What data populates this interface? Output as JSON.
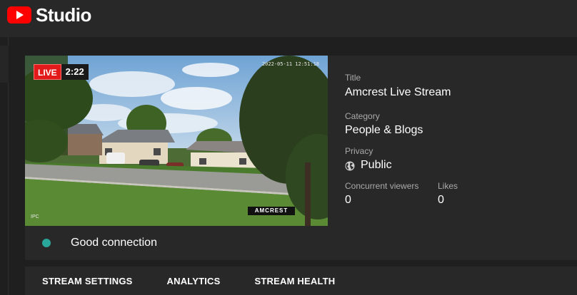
{
  "app": {
    "logo_text": "Studio"
  },
  "video": {
    "live_label": "LIVE",
    "elapsed": "2:22",
    "camera_timestamp": "2022-05-11 12:51:18",
    "camera_label": "IPC",
    "camera_brand": "AMCREST"
  },
  "connection": {
    "status": "Good connection",
    "status_color": "#2aa79b"
  },
  "details": {
    "title_label": "Title",
    "title_value": "Amcrest Live Stream",
    "category_label": "Category",
    "category_value": "People & Blogs",
    "privacy_label": "Privacy",
    "privacy_value": "Public",
    "privacy_icon": "globe-icon",
    "viewers_label": "Concurrent viewers",
    "viewers_value": "0",
    "likes_label": "Likes",
    "likes_value": "0"
  },
  "tabs": [
    {
      "label": "STREAM SETTINGS"
    },
    {
      "label": "ANALYTICS"
    },
    {
      "label": "STREAM HEALTH"
    }
  ],
  "colors": {
    "brand_red": "#ff0000",
    "live_red": "#e31a1a",
    "background": "#1f1f1f",
    "panel": "#282828"
  }
}
